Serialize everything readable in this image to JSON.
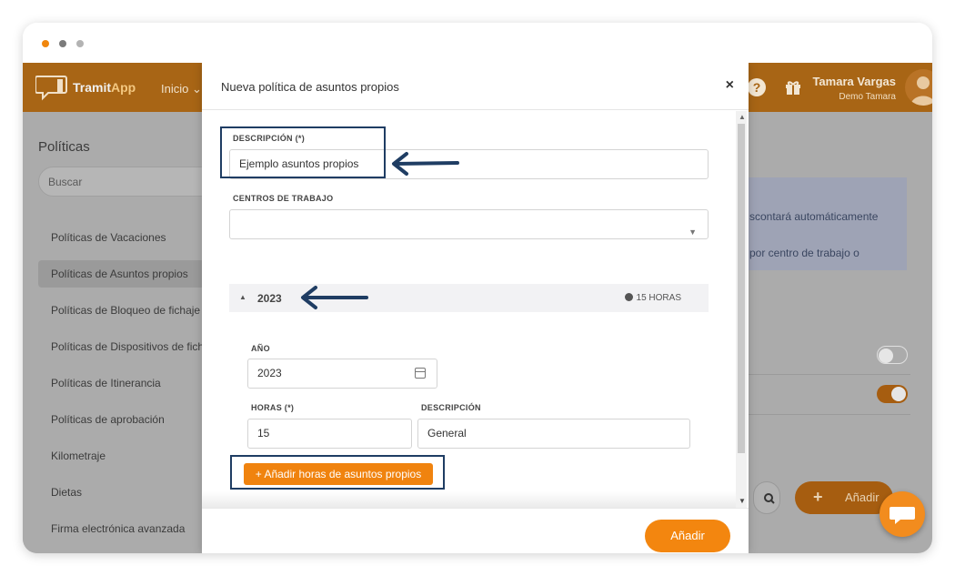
{
  "window": {
    "controls": [
      "close",
      "minimize",
      "maximize"
    ]
  },
  "topnav": {
    "logo_text": "Tramit",
    "logo_text_app": "App",
    "menu_inicio": "Inicio",
    "help_icon": "?",
    "user_name": "Tamara Vargas",
    "user_company": "Demo Tamara"
  },
  "sidebar": {
    "title": "Políticas",
    "search_placeholder": "Buscar",
    "items": [
      {
        "label": "Políticas de Vacaciones"
      },
      {
        "label": "Políticas de Asuntos propios"
      },
      {
        "label": "Políticas de Bloqueo de fichaje"
      },
      {
        "label": "Políticas de Dispositivos de fich"
      },
      {
        "label": "Políticas de Itinerancia"
      },
      {
        "label": "Políticas de aprobación"
      },
      {
        "label": "Kilometraje"
      },
      {
        "label": "Dietas"
      },
      {
        "label": "Firma electrónica avanzada"
      }
    ],
    "active_index": 1
  },
  "background": {
    "info_line1": "scontará automáticamente",
    "info_line2": "por centro de trabajo o",
    "add_button": "Añadir",
    "toggle1_on": false,
    "toggle2_on": true
  },
  "modal": {
    "title": "Nueva política de asuntos propios",
    "close_icon": "×",
    "descripcion_label": "DESCRIPCIÓN (*)",
    "descripcion_value": "Ejemplo asuntos propios",
    "centros_label": "CENTROS DE TRABAJO",
    "centros_value": "",
    "year_section": {
      "year": "2023",
      "hours": "15 HORAS"
    },
    "ano_label": "AÑO",
    "ano_value": "2023",
    "horas_label": "HORAS (*)",
    "horas_value": "15",
    "desc2_label": "DESCRIPCIÓN",
    "desc2_value": "General",
    "add_hours_button": "Añadir horas de asuntos propios",
    "footer_add": "Añadir"
  },
  "colors": {
    "accent": "#f0830f",
    "annotation": "#1f3d63",
    "topnav_dimmed": "#a86515"
  }
}
